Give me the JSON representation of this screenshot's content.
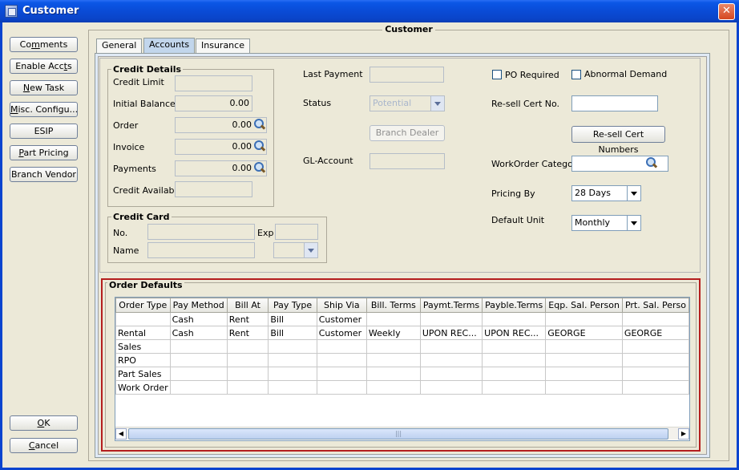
{
  "window": {
    "title": "Customer",
    "close_glyph": "✕"
  },
  "group_title": "Customer",
  "sidebar": {
    "comments": {
      "pre": "Co",
      "u": "m",
      "post": "ments"
    },
    "enable_accts": {
      "pre": "Enable Acc",
      "u": "t",
      "post": "s"
    },
    "new_task": {
      "pre": "",
      "u": "N",
      "post": "ew Task"
    },
    "misc": {
      "pre": "",
      "u": "M",
      "post": "isc. Configu..."
    },
    "esip": {
      "pre": "ESIP",
      "u": "",
      "post": ""
    },
    "part_pricing": {
      "pre": "",
      "u": "P",
      "post": "art Pricing"
    },
    "branch_vendor": {
      "pre": "Branch Vendor",
      "u": "",
      "post": ""
    },
    "ok": {
      "pre": "",
      "u": "O",
      "post": "K"
    },
    "cancel": {
      "pre": "",
      "u": "C",
      "post": "ancel"
    }
  },
  "tabs": [
    "General",
    "Accounts",
    "Insurance"
  ],
  "active_tab": "Accounts",
  "credit_details": {
    "legend": "Credit Details",
    "credit_limit_label": "Credit Limit",
    "initial_balance_label": "Initial Balance",
    "initial_balance": "0.00",
    "order_label": "Order",
    "order": "0.00",
    "invoice_label": "Invoice",
    "invoice": "0.00",
    "payments_label": "Payments",
    "payments": "0.00",
    "credit_available_label": "Credit Available"
  },
  "credit_card": {
    "legend": "Credit Card",
    "no_label": "No.",
    "exp_label": "Exp",
    "name_label": "Name"
  },
  "middle": {
    "last_payment_label": "Last Payment",
    "status_label": "Status",
    "status_value": "Potential",
    "branch_dealer_label": "Branch Dealer",
    "gl_account_label": "GL-Account"
  },
  "right": {
    "po_required_label": "PO Required",
    "abnormal_demand_label": "Abnormal Demand",
    "resell_cert_label": "Re-sell Cert No.",
    "resell_cert_button": "Re-sell Cert Numbers",
    "workorder_category_label": "WorkOrder Category",
    "pricing_by_label": "Pricing By",
    "pricing_by_value": "28 Days",
    "default_unit_label": "Default Unit",
    "default_unit_value": "Monthly"
  },
  "order_defaults": {
    "legend": "Order Defaults",
    "columns": [
      "Order Type",
      "Pay Method",
      "Bill At",
      "Pay Type",
      "Ship Via",
      "Bill. Terms",
      "Paymt.Terms",
      "Payble.Terms",
      "Eqp. Sal. Person",
      "Prt. Sal. Perso"
    ],
    "rows": [
      [
        "",
        "Cash",
        "Rent",
        "Bill",
        "Customer",
        "",
        "",
        "",
        "",
        ""
      ],
      [
        "Rental",
        "Cash",
        "Rent",
        "Bill",
        "Customer",
        "Weekly",
        "UPON REC...",
        "UPON REC...",
        "GEORGE",
        "GEORGE"
      ],
      [
        "Sales",
        "",
        "",
        "",
        "",
        "",
        "",
        "",
        "",
        ""
      ],
      [
        "RPO",
        "",
        "",
        "",
        "",
        "",
        "",
        "",
        "",
        ""
      ],
      [
        "Part Sales",
        "",
        "",
        "",
        "",
        "",
        "",
        "",
        "",
        ""
      ],
      [
        "Work Order",
        "",
        "",
        "",
        "",
        "",
        "",
        "",
        "",
        ""
      ]
    ],
    "scroll_left": "◀",
    "scroll_right": "▶",
    "thumb_grip": "|||"
  }
}
